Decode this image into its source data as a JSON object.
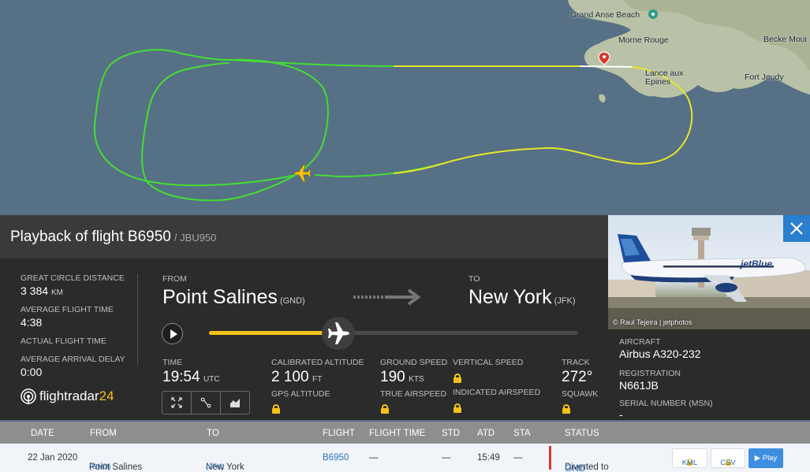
{
  "map": {
    "labels": [
      "Grand Anse Beach",
      "Morne Rouge",
      "Becke Moui",
      "Lance aux Epines",
      "Fort Jeudy"
    ],
    "colors": {
      "sea": "#567085",
      "land": "#b9c2a6",
      "track_green": "#44dd33",
      "track_yellow": "#e6e629"
    }
  },
  "header": {
    "title": "Playback of flight B6950",
    "callsign": "/ JBU950"
  },
  "stats": {
    "gcd_label": "GREAT CIRCLE DISTANCE",
    "gcd_value": "3 384",
    "gcd_unit": "KM",
    "aft_label": "AVERAGE FLIGHT TIME",
    "aft_value": "4:38",
    "actual_label": "ACTUAL FLIGHT TIME",
    "delay_label": "AVERAGE ARRIVAL DELAY",
    "delay_value": "0:00"
  },
  "logo": {
    "text": "flightradar",
    "num": "24"
  },
  "route": {
    "from_label": "FROM",
    "from_city": "Point Salines",
    "from_code": "(GND)",
    "to_label": "TO",
    "to_city": "New York",
    "to_code": "(JFK)"
  },
  "playback": {
    "progress": 0.35
  },
  "live": {
    "time_label": "TIME",
    "time_value": "19:54",
    "time_unit": "UTC",
    "cas_label": "CALIBRATED ALTITUDE",
    "cas_value": "2 100",
    "cas_unit": "FT",
    "gps_label": "GPS ALTITUDE",
    "gs_label": "GROUND SPEED",
    "gs_value": "190",
    "gs_unit": "KTS",
    "tas_label": "TRUE AIRSPEED",
    "vs_label": "VERTICAL SPEED",
    "ias_label": "INDICATED AIRSPEED",
    "track_label": "TRACK",
    "track_value": "272°",
    "squawk_label": "SQUAWK"
  },
  "tools": [
    "expand-icon",
    "route-icon",
    "chart-icon"
  ],
  "aircraft": {
    "photo_credit": "© Raul Tejeira | jetphotos",
    "livery_text": "jetBlue",
    "type_label": "AIRCRAFT",
    "type_value": "Airbus A320-232",
    "reg_label": "REGISTRATION",
    "reg_value": "N661JB",
    "msn_label": "SERIAL NUMBER (MSN)",
    "msn_value": "-"
  },
  "table": {
    "headers": {
      "date": "DATE",
      "from": "FROM",
      "to": "TO",
      "flight": "FLIGHT",
      "flight_time": "FLIGHT TIME",
      "std": "STD",
      "atd": "ATD",
      "sta": "STA",
      "status": "STATUS"
    },
    "row": {
      "date": "22 Jan 2020",
      "from": "Point Salines",
      "from_code": "(GND)",
      "to": "New York",
      "to_code": "(JFK)",
      "flight": "B6950",
      "flight_time": "—",
      "std": "—",
      "atd": "15:49",
      "sta": "—",
      "status": "Diverted to",
      "status_code": "GND",
      "kml": "KML",
      "csv": "CSV",
      "play": "▶ Play"
    }
  }
}
